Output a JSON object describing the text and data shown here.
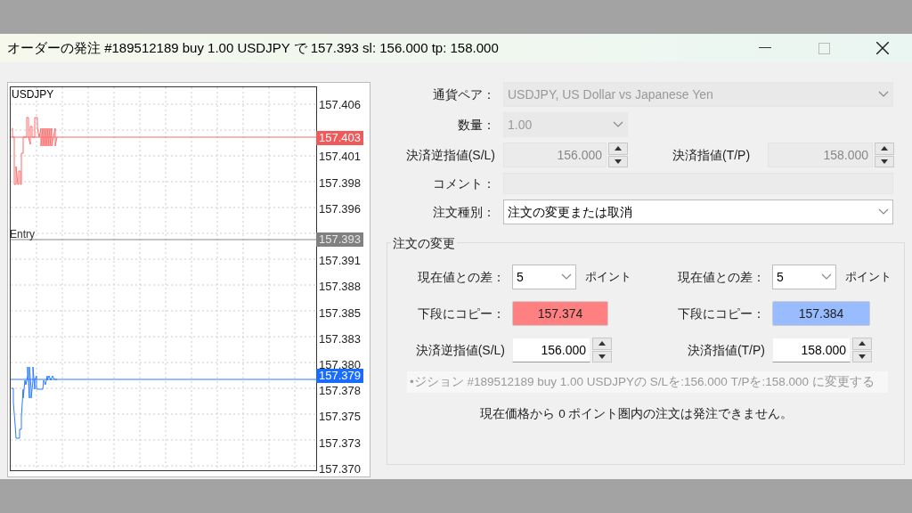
{
  "window": {
    "title": "オーダーの発注 #189512189 buy 1.00 USDJPY で 157.393 sl: 156.000 tp: 158.000"
  },
  "chart": {
    "symbol": "USDJPY",
    "entry_label": "Entry",
    "axis_labels": [
      "157.406",
      "157.401",
      "157.398",
      "157.396",
      "157.391",
      "157.388",
      "157.385",
      "157.383",
      "157.380",
      "157.378",
      "157.375",
      "157.373",
      "157.370"
    ],
    "bid_badge": "157.403",
    "entry_badge": "157.393",
    "ask_badge": "157.379"
  },
  "form": {
    "symbol": {
      "label": "通貨ペア：",
      "value": "USDJPY, US Dollar vs Japanese Yen",
      "disabled": true
    },
    "volume": {
      "label": "数量：",
      "value": "1.00",
      "disabled": true
    },
    "stop_loss": {
      "label": "決済逆指値(S/L)",
      "value": "156.000",
      "disabled": true
    },
    "take_profit": {
      "label": "決済指値(T/P)",
      "value": "158.000",
      "disabled": true
    },
    "comment": {
      "label": "コメント：",
      "disabled": true
    },
    "order_type": {
      "label": "注文種別：",
      "value": "注文の変更または取消",
      "disabled": false
    }
  },
  "modify": {
    "title": "注文の変更",
    "columns": [
      {
        "diff_label": "現在値との差：",
        "diff_value": "5",
        "unit": "ポイント",
        "copy_label": "下段にコピー：",
        "copy_value": "157.374",
        "color": "#ff8080",
        "price_label": "決済逆指値(S/L)",
        "price_value": "156.000"
      },
      {
        "diff_label": "現在値との差：",
        "diff_value": "5",
        "unit": "ポイント",
        "copy_label": "下段にコピー：",
        "copy_value": "157.384",
        "color": "#99bbff",
        "price_label": "決済指値(T/P)",
        "price_value": "158.000"
      }
    ],
    "summary": {
      "label": "•ジション #189512189 buy 1.00 USDJPYの S/Lを:156.000 T/Pを:158.000 に変更する",
      "disabled": true
    },
    "notice": "現在価格から 0 ポイント圏内の注文は発注できません。"
  }
}
